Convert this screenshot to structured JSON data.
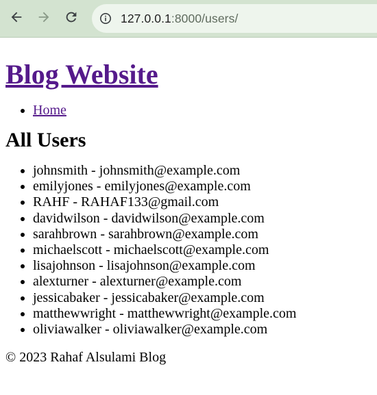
{
  "browser": {
    "url_host": "127.0.0.1",
    "url_rest": ":8000/users/",
    "icons": {
      "back": "back-arrow-icon",
      "forward": "forward-arrow-icon",
      "reload": "reload-icon",
      "info": "info-icon"
    },
    "toolbar_color": "#d3e3d0",
    "omnibox_color": "#eef5ed"
  },
  "site": {
    "title": "Blog Website",
    "link_color": "#551a8b",
    "nav": [
      {
        "label": "Home"
      }
    ]
  },
  "users_section": {
    "heading": "All Users",
    "users": [
      {
        "username": "johnsmith",
        "email": "johnsmith@example.com"
      },
      {
        "username": "emilyjones",
        "email": "emilyjones@example.com"
      },
      {
        "username": "RAHF",
        "email": "RAHAF133@gmail.com"
      },
      {
        "username": "davidwilson",
        "email": "davidwilson@example.com"
      },
      {
        "username": "sarahbrown",
        "email": "sarahbrown@example.com"
      },
      {
        "username": "michaelscott",
        "email": "michaelscott@example.com"
      },
      {
        "username": "lisajohnson",
        "email": "lisajohnson@example.com"
      },
      {
        "username": "alexturner",
        "email": "alexturner@example.com"
      },
      {
        "username": "jessicabaker",
        "email": "jessicabaker@example.com"
      },
      {
        "username": "matthewwright",
        "email": "matthewwright@example.com"
      },
      {
        "username": "oliviawalker",
        "email": "oliviawalker@example.com"
      }
    ],
    "separator": " - "
  },
  "footer": {
    "text": "© 2023 Rahaf Alsulami Blog"
  }
}
